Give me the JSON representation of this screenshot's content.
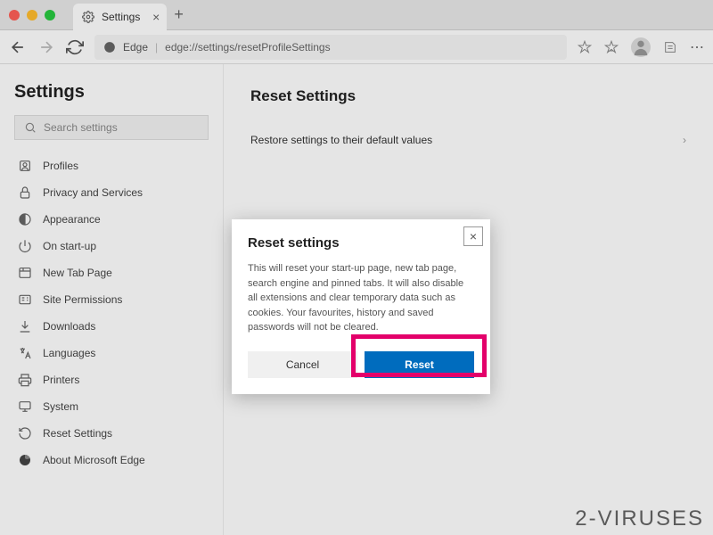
{
  "window": {
    "tab_title": "Settings"
  },
  "toolbar": {
    "addr_prefix": "Edge",
    "addr_url": "edge://settings/resetProfileSettings"
  },
  "sidebar": {
    "title": "Settings",
    "search_placeholder": "Search settings",
    "items": [
      {
        "label": "Profiles",
        "icon": "profile-icon"
      },
      {
        "label": "Privacy and Services",
        "icon": "lock-icon"
      },
      {
        "label": "Appearance",
        "icon": "appearance-icon"
      },
      {
        "label": "On start-up",
        "icon": "power-icon"
      },
      {
        "label": "New Tab Page",
        "icon": "newtab-icon"
      },
      {
        "label": "Site Permissions",
        "icon": "permissions-icon"
      },
      {
        "label": "Downloads",
        "icon": "download-icon"
      },
      {
        "label": "Languages",
        "icon": "languages-icon"
      },
      {
        "label": "Printers",
        "icon": "printer-icon"
      },
      {
        "label": "System",
        "icon": "system-icon"
      },
      {
        "label": "Reset Settings",
        "icon": "reset-icon"
      },
      {
        "label": "About Microsoft Edge",
        "icon": "edge-icon"
      }
    ]
  },
  "main": {
    "heading": "Reset Settings",
    "row": "Restore settings to their default values"
  },
  "modal": {
    "title": "Reset settings",
    "body": "This will reset your start-up page, new tab page, search engine and pinned tabs. It will also disable all extensions and clear temporary data such as cookies. Your favourites, history and saved passwords will not be cleared.",
    "cancel": "Cancel",
    "reset": "Reset"
  },
  "watermark": "2-VIRUSES"
}
